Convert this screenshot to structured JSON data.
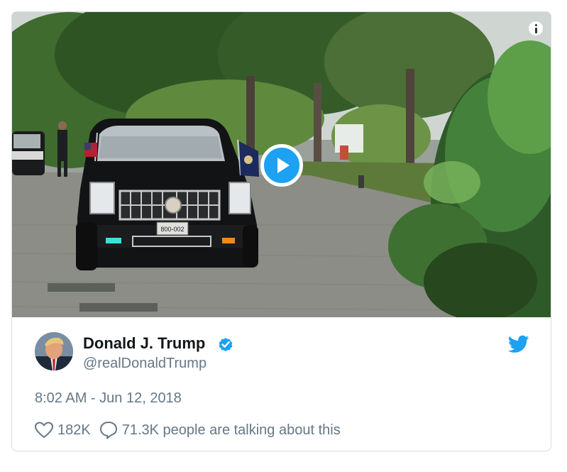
{
  "tweet": {
    "author": {
      "display_name": "Donald J. Trump",
      "handle": "@realDonaldTrump",
      "verified": true
    },
    "timestamp": "8:02 AM - Jun 12, 2018",
    "likes": "182K",
    "conversation": "71.3K people are talking about this",
    "media": {
      "type": "video",
      "plate_text": "800-002"
    }
  },
  "colors": {
    "accent": "#1da1f2",
    "text_primary": "#14171a",
    "text_secondary": "#657786",
    "card_border": "#d6dde3"
  },
  "icons": {
    "play": "play-icon",
    "info": "info-icon",
    "verified": "verified-badge-icon",
    "brand": "twitter-bird-icon",
    "like": "heart-icon",
    "reply": "speech-bubble-icon"
  }
}
